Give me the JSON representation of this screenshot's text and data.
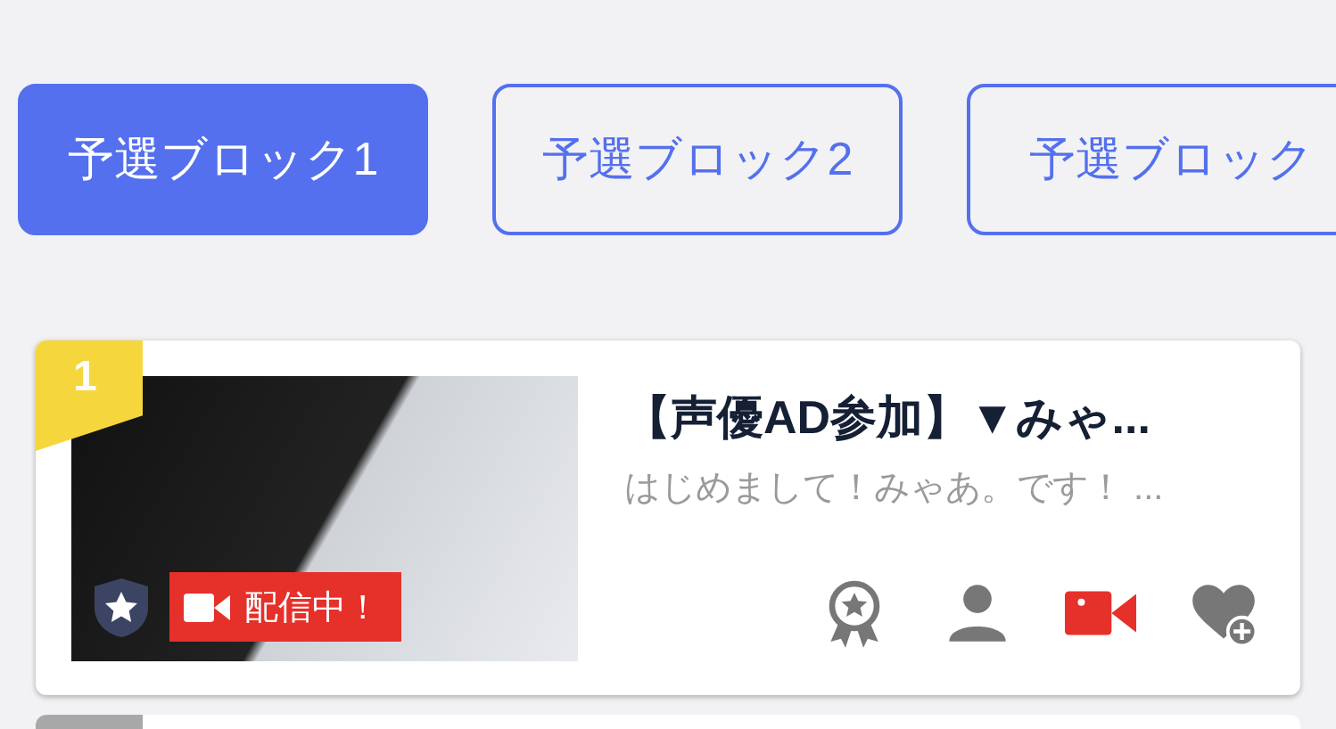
{
  "tabs": [
    {
      "label": "予選ブロック1",
      "selected": true
    },
    {
      "label": "予選ブロック2",
      "selected": false
    },
    {
      "label": "予選ブロック",
      "selected": false
    }
  ],
  "cards": [
    {
      "rank": "1",
      "title": "【声優AD参加】▼みゃ...",
      "description": "はじめまして！みゃあ。です！ ...",
      "live": true,
      "live_label": "配信中！"
    }
  ]
}
